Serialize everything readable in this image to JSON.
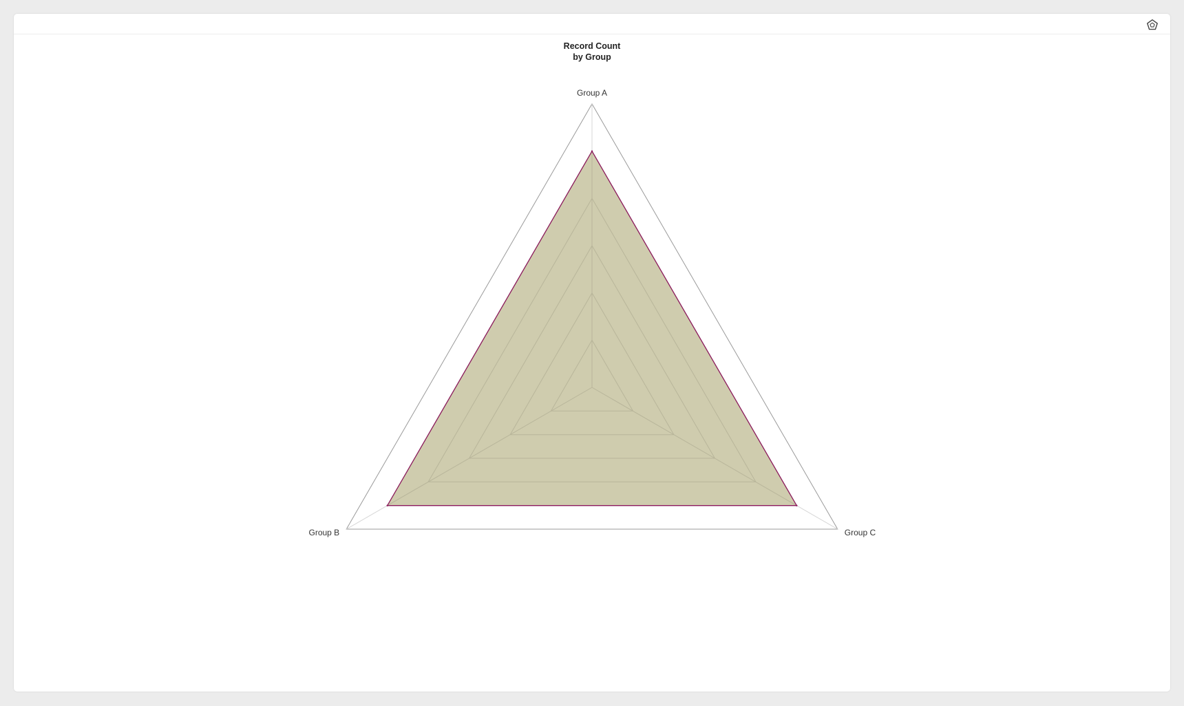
{
  "toolbar": {
    "chart_type_icon": "pentagon-radar-icon"
  },
  "colors": {
    "page_background": "#ececec",
    "panel_background": "#ffffff",
    "area_fill": "#cfccae",
    "area_stroke": "#8b1a5c",
    "grid_line": "#b8b59a",
    "outer_frame": "#9a9a9a"
  },
  "chart_data": {
    "type": "radar",
    "title": [
      "Record Count",
      "by Group"
    ],
    "categories": [
      "Group A",
      "Group B",
      "Group C"
    ],
    "series": [
      {
        "values": [
          5,
          5,
          5
        ]
      }
    ],
    "range": [
      0,
      6
    ],
    "grid_levels": [
      1,
      2,
      3,
      4,
      5
    ],
    "grid": true,
    "legend": "none"
  }
}
